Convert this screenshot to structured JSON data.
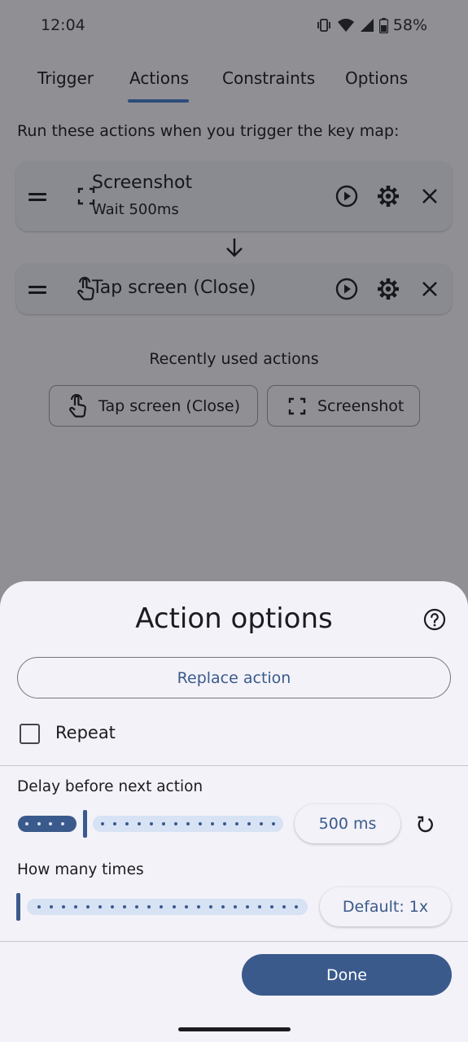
{
  "status_bar": {
    "time": "12:04",
    "battery": "58%"
  },
  "tabs": [
    {
      "label": "Trigger"
    },
    {
      "label": "Actions",
      "selected": true
    },
    {
      "label": "Constraints"
    },
    {
      "label": "Options"
    }
  ],
  "intro_text": "Run these actions when you trigger the key map:",
  "actions": [
    {
      "title": "Screenshot",
      "subtitle": "Wait 500ms",
      "icon": "screenshot-icon"
    },
    {
      "title": "Tap screen (Close)",
      "icon": "tap-icon"
    }
  ],
  "recent": {
    "title": "Recently used actions",
    "chips": [
      {
        "label": "Tap screen (Close)",
        "icon": "tap-icon"
      },
      {
        "label": "Screenshot",
        "icon": "screenshot-icon"
      }
    ]
  },
  "sheet": {
    "title": "Action options",
    "replace_label": "Replace action",
    "repeat_label": "Repeat",
    "repeat_checked": false,
    "delay_label": "Delay before next action",
    "delay_value": "500 ms",
    "how_many_label": "How many times",
    "how_many_value": "Default: 1x",
    "done_label": "Done"
  },
  "colors": {
    "accent": "#3a5a8c",
    "scrim": "#8f8f94",
    "sheet": "#f3f2f8",
    "track": "#d7e2f4"
  }
}
